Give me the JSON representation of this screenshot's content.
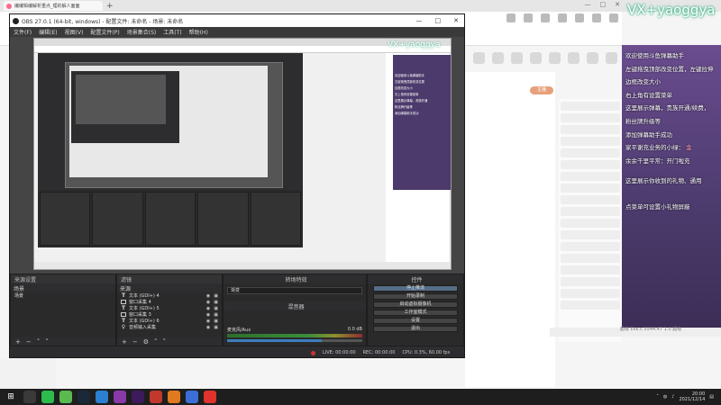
{
  "browser": {
    "tab_title": "编编辑编解析重点_理的解人面面",
    "new_tab": "+",
    "window_controls": [
      "—",
      "□",
      "✕"
    ],
    "pill": "主播",
    "ticker": "超级 Ekk.c 5544.47 1.0 超级"
  },
  "overlay": {
    "watermark": "VX+yaoggya",
    "help_lines": [
      "欢迎使用斗鱼弹幕助手",
      "左键拖曳顶部改变位置，左键拉伸",
      "边框改变大小",
      "右上角有设置菜单",
      "这里展示弹幕，贵族开通/续费，",
      "粉丝牌升级等",
      "添加弹幕助手成功"
    ],
    "accent_lines": [
      "家平谢充业务的小绿：",
      "余余千里平常：开门啦充"
    ],
    "accent_suffix": "金",
    "gift_lines": [
      "这里展示你收到的礼物、通用",
      "点菜单可设置小礼物屏蔽"
    ]
  },
  "obs": {
    "title": "OBS 27.0.1 (64-bit, windows) - 配置文件: 未命名 - 场景: 未命名",
    "window_controls": [
      "—",
      "□",
      "✕"
    ],
    "menu": [
      "文件(F)",
      "编辑(E)",
      "视图(V)",
      "配置文件(P)",
      "场景集合(S)",
      "工具(T)",
      "帮助(H)"
    ],
    "nested_watermark": "VX+yaoggya",
    "nested_help": [
      "欢迎使用斗鱼弹幕助手",
      "左键拖曳顶部改变位置",
      "边框改变大小",
      "右上角有设置菜单",
      "这里展示弹幕，贵族开通",
      "粉丝牌升级等",
      "添加弹幕助手成功"
    ],
    "docks": {
      "scene_tab_a": "来源设置",
      "scene_tab_b": "滤镜",
      "scenes_header": "场景",
      "scenes": [
        "场景"
      ],
      "sources_header": "来源",
      "sources": [
        {
          "type": "text",
          "name": "文本 (GDI+) 4"
        },
        {
          "type": "window",
          "name": "窗口采集 4"
        },
        {
          "type": "text",
          "name": "文本 (GDI+) 5"
        },
        {
          "type": "window",
          "name": "窗口采集 3"
        },
        {
          "type": "text",
          "name": "文本 (GDI+) 6"
        },
        {
          "type": "text",
          "name": "音频输入采集"
        }
      ],
      "transitions_header": "转场特效",
      "transition_value": "渐变",
      "mixer_header": "混音器",
      "mixer_track": "麦克风/Aux",
      "mixer_db": "0.0 dB",
      "mixer_volume": 0.7,
      "controls_header": "控件",
      "controls": [
        "停止推流",
        "开始录制",
        "启动虚拟摄像机",
        "工作室模式",
        "设置",
        "退出"
      ]
    },
    "status": {
      "live": "LIVE: 00:00:00",
      "rec": "REC: 00:00:00",
      "cpu": "CPU: 0.3%, 60.00 fps"
    }
  },
  "taskbar": {
    "start_icon": "windows-start-icon",
    "time": "20:00",
    "date": "2021/12/14",
    "apps": [
      {
        "name": "obs-icon",
        "color": "#3a3a3a"
      },
      {
        "name": "wechat-icon",
        "color": "#2dbb4e"
      },
      {
        "name": "green-app-icon",
        "color": "#5ab94f"
      },
      {
        "name": "steam-icon",
        "color": "#1b2838"
      },
      {
        "name": "vscode-icon",
        "color": "#2b7fd0"
      },
      {
        "name": "purple-app-icon",
        "color": "#8a3aa8"
      },
      {
        "name": "premiere-icon",
        "color": "#3d1a5b"
      },
      {
        "name": "red-app-icon",
        "color": "#c0392b"
      },
      {
        "name": "orange-app-icon",
        "color": "#e07a1f"
      },
      {
        "name": "blue-app-icon",
        "color": "#3a6fd8"
      },
      {
        "name": "netease-icon",
        "color": "#e0332c"
      }
    ]
  }
}
